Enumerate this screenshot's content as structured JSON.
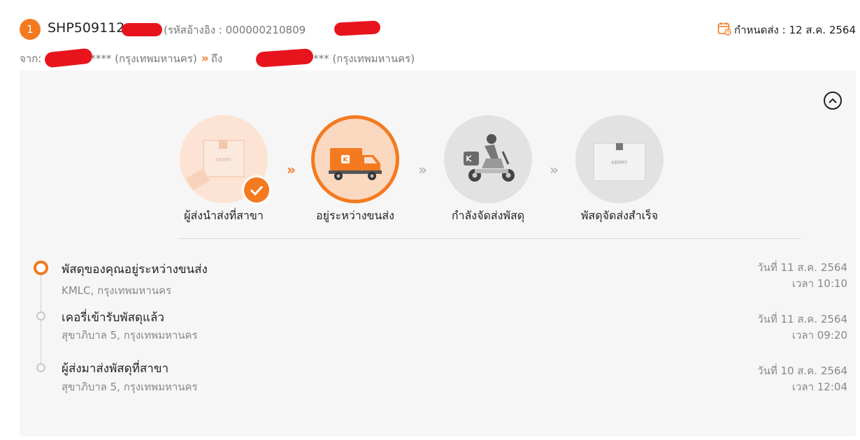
{
  "shipment": {
    "index": "1",
    "tracking_no": "SHP509112",
    "reference": "(รหัสอ้างอิง : 000000210809",
    "due_label": "กำหนดส่ง : 12 ส.ค. 2564",
    "from_prefix": "จาก:",
    "from_masked": "****",
    "from_city": "(กรุงเทพมหานคร)",
    "to_prefix": "ถึง",
    "to_masked": "*******",
    "to_city": "(กรุงเทพมหานคร)"
  },
  "steps": [
    {
      "label": "ผู้ส่งนำส่งที่สาขา",
      "state": "done"
    },
    {
      "label": "อยู่ระหว่างขนส่ง",
      "state": "current"
    },
    {
      "label": "กำลังจัดส่งพัสดุ",
      "state": "pending"
    },
    {
      "label": "พัสดุจัดส่งสำเร็จ",
      "state": "pending"
    }
  ],
  "timeline": [
    {
      "title": "พัสดุของคุณอยู่ระหว่างขนส่ง",
      "location": "KMLC, กรุงเทพมหานคร",
      "date": "วันที่ 11 ส.ค. 2564",
      "time": "เวลา 10:10"
    },
    {
      "title": "เคอรี่เข้ารับพัสดุแล้ว",
      "location": "สุขาภิบาล 5, กรุงเทพมหานคร",
      "date": "วันที่ 11 ส.ค. 2564",
      "time": "เวลา 09:20"
    },
    {
      "title": "ผู้ส่งมาส่งพัสดุที่สาขา",
      "location": "สุขาภิบาล 5, กรุงเทพมหานคร",
      "date": "วันที่ 10 ส.ค. 2564",
      "time": "เวลา 12:04"
    }
  ],
  "colors": {
    "accent": "#f47a20",
    "redaction": "#e8141d",
    "panel": "#f6f6f6"
  },
  "icons": [
    "calendar-icon",
    "collapse-chevron-up-icon",
    "check-icon",
    "truck-icon",
    "scooter-courier-icon",
    "parcel-box-icon"
  ]
}
